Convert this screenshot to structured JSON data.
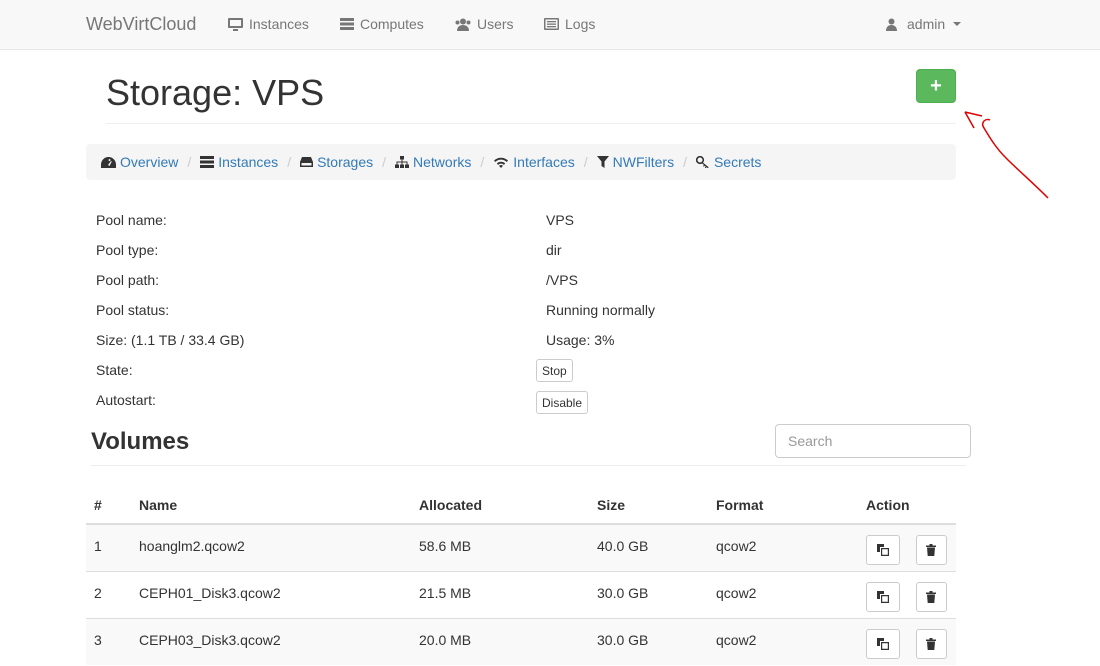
{
  "nav": {
    "brand": "WebVirtCloud",
    "items": [
      {
        "label": "Instances",
        "icon": "monitor-icon"
      },
      {
        "label": "Computes",
        "icon": "server-icon"
      },
      {
        "label": "Users",
        "icon": "users-icon"
      },
      {
        "label": "Logs",
        "icon": "list-icon"
      }
    ],
    "user": "admin"
  },
  "page": {
    "title": "Storage: VPS",
    "add_label": "+"
  },
  "breadcrumb": [
    {
      "label": "Overview",
      "icon": "dashboard-icon"
    },
    {
      "label": "Instances",
      "icon": "server-icon"
    },
    {
      "label": "Storages",
      "icon": "hdd-icon"
    },
    {
      "label": "Networks",
      "icon": "sitemap-icon"
    },
    {
      "label": "Interfaces",
      "icon": "wifi-icon"
    },
    {
      "label": "NWFilters",
      "icon": "filter-icon"
    },
    {
      "label": "Secrets",
      "icon": "key-icon"
    }
  ],
  "info": {
    "pool_name_label": "Pool name:",
    "pool_name": "VPS",
    "pool_type_label": "Pool type:",
    "pool_type": "dir",
    "pool_path_label": "Pool path:",
    "pool_path": "/VPS",
    "pool_status_label": "Pool status:",
    "pool_status": "Running normally",
    "size_label": "Size: (1.1 TB / 33.4 GB)",
    "usage": "Usage: 3%",
    "state_label": "State:",
    "state_button": "Stop",
    "autostart_label": "Autostart:",
    "autostart_button": "Disable"
  },
  "volumes": {
    "title": "Volumes",
    "search_placeholder": "Search",
    "headers": [
      "#",
      "Name",
      "Allocated",
      "Size",
      "Format",
      "Action"
    ],
    "rows": [
      {
        "num": "1",
        "name": "hoanglm2.qcow2",
        "allocated": "58.6 MB",
        "size": "40.0 GB",
        "format": "qcow2"
      },
      {
        "num": "2",
        "name": "CEPH01_Disk3.qcow2",
        "allocated": "21.5 MB",
        "size": "30.0 GB",
        "format": "qcow2"
      },
      {
        "num": "3",
        "name": "CEPH03_Disk3.qcow2",
        "allocated": "20.0 MB",
        "size": "30.0 GB",
        "format": "qcow2"
      }
    ]
  },
  "colors": {
    "success": "#5cb85c",
    "link": "#337ab7",
    "annotation": "#e00000"
  }
}
